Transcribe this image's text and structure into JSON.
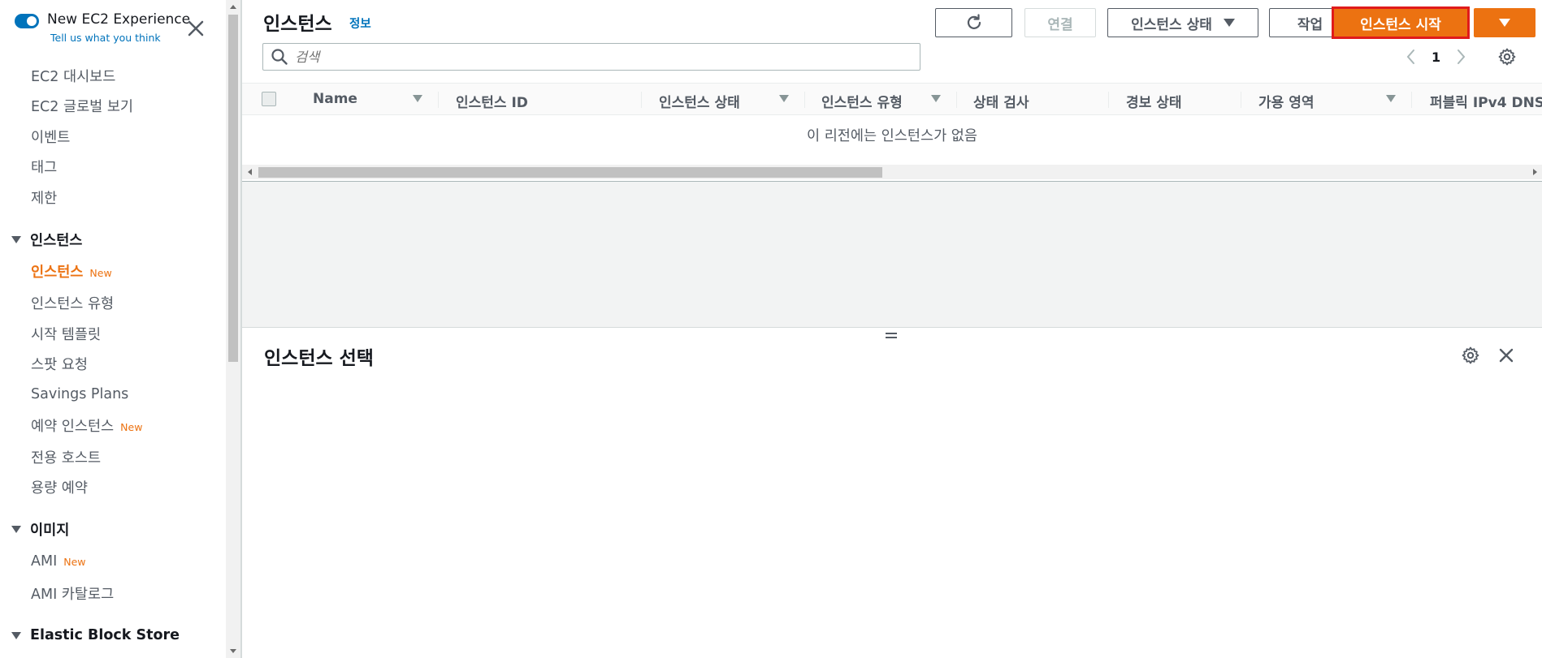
{
  "sidebar": {
    "toggle_title": "New EC2 Experience",
    "toggle_link": "Tell us what you think",
    "items": [
      {
        "label": "EC2 대시보드"
      },
      {
        "label": "EC2 글로벌 보기"
      },
      {
        "label": "이벤트"
      },
      {
        "label": "태그"
      },
      {
        "label": "제한"
      }
    ],
    "sections": [
      {
        "title": "인스턴스",
        "items": [
          {
            "label": "인스턴스",
            "badge": "New"
          },
          {
            "label": "인스턴스 유형"
          },
          {
            "label": "시작 템플릿"
          },
          {
            "label": "스팟 요청"
          },
          {
            "label": "Savings Plans"
          },
          {
            "label": "예약 인스턴스",
            "badge": "New"
          },
          {
            "label": "전용 호스트"
          },
          {
            "label": "용량 예약"
          }
        ]
      },
      {
        "title": "이미지",
        "items": [
          {
            "label": "AMI",
            "badge": "New"
          },
          {
            "label": "AMI 카탈로그"
          }
        ]
      },
      {
        "title": "Elastic Block Store"
      }
    ]
  },
  "header": {
    "title": "인스턴스",
    "info_link": "정보",
    "connect_label": "연결",
    "instance_state_label": "인스턴스 상태",
    "actions_label": "작업",
    "launch_label": "인스턴스 시작"
  },
  "search": {
    "placeholder": "검색"
  },
  "pagination": {
    "current_page": "1"
  },
  "table": {
    "columns": [
      "Name",
      "인스턴스 ID",
      "인스턴스 상태",
      "인스턴스 유형",
      "상태 검사",
      "경보 상태",
      "가용 영역",
      "퍼블릭 IPv4 DNS"
    ],
    "empty_message": "이 리전에는 인스턴스가 없음"
  },
  "split_panel": {
    "title": "인스턴스 선택"
  },
  "colors": {
    "accent": "#ec7211",
    "link": "#0073bb",
    "highlight_border": "#e01b1b"
  }
}
